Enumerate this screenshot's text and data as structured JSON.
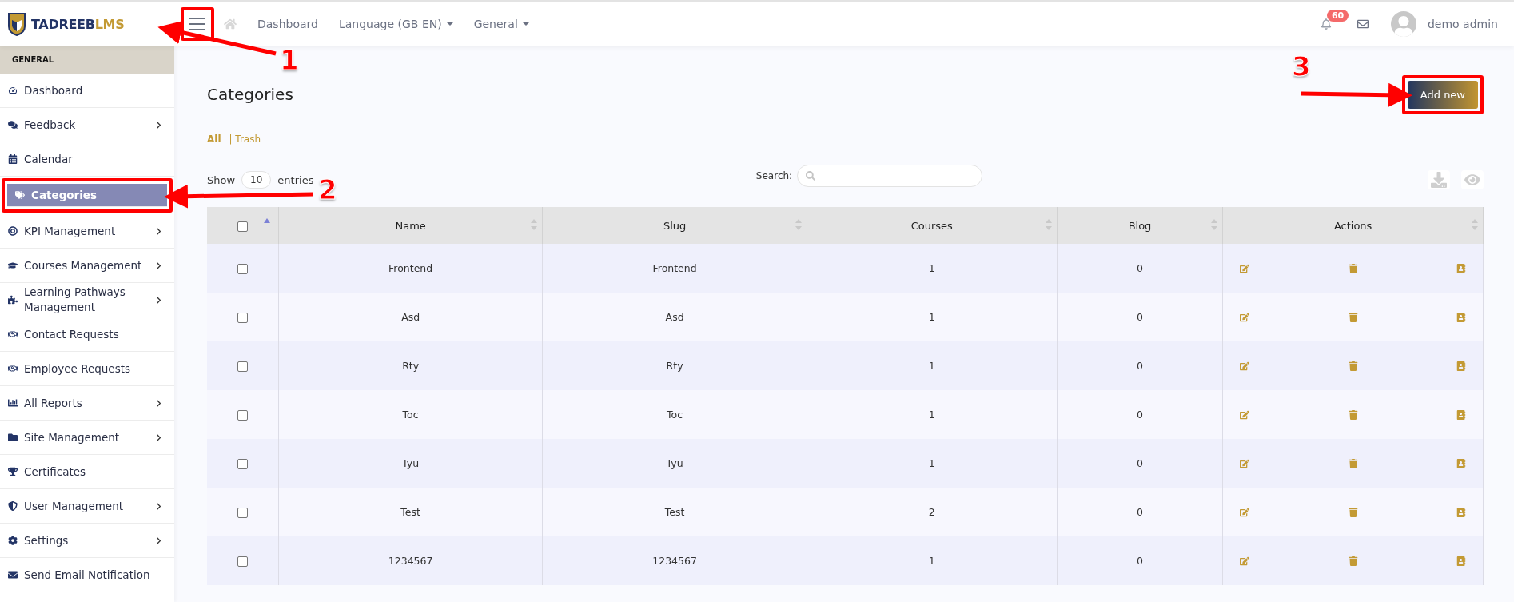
{
  "brand": {
    "name": "TADREEB",
    "suffix": "LMS"
  },
  "menu_button": {
    "annotated": true
  },
  "top_nav": [
    {
      "label": "Dashboard",
      "dropdown": false
    },
    {
      "label": "Language (GB EN)",
      "dropdown": true
    },
    {
      "label": "General",
      "dropdown": true
    }
  ],
  "notifications": {
    "count": "60"
  },
  "user": {
    "name": "demo admin"
  },
  "sidebar": {
    "section": "GENERAL",
    "items": [
      {
        "label": "Dashboard",
        "has_submenu": false,
        "selected": false,
        "annotated": false
      },
      {
        "label": "Feedback",
        "has_submenu": true,
        "selected": false,
        "annotated": false
      },
      {
        "label": "Calendar",
        "has_submenu": false,
        "selected": false,
        "annotated": false
      },
      {
        "label": "Categories",
        "has_submenu": false,
        "selected": true,
        "annotated": true
      },
      {
        "label": "KPI Management",
        "has_submenu": true,
        "selected": false,
        "annotated": false
      },
      {
        "label": "Courses Management",
        "has_submenu": true,
        "selected": false,
        "annotated": false
      },
      {
        "label": "Learning Pathways Management",
        "has_submenu": true,
        "selected": false,
        "annotated": false
      },
      {
        "label": "Contact Requests",
        "has_submenu": false,
        "selected": false,
        "annotated": false
      },
      {
        "label": "Employee Requests",
        "has_submenu": false,
        "selected": false,
        "annotated": false
      },
      {
        "label": "All Reports",
        "has_submenu": true,
        "selected": false,
        "annotated": false
      },
      {
        "label": "Site Management",
        "has_submenu": true,
        "selected": false,
        "annotated": false
      },
      {
        "label": "Certificates",
        "has_submenu": false,
        "selected": false,
        "annotated": false
      },
      {
        "label": "User Management",
        "has_submenu": true,
        "selected": false,
        "annotated": false
      },
      {
        "label": "Settings",
        "has_submenu": true,
        "selected": false,
        "annotated": false
      },
      {
        "label": "Send Email Notification",
        "has_submenu": false,
        "selected": false,
        "annotated": false
      }
    ]
  },
  "page_title": "Categories",
  "add_button": {
    "label": "Add new",
    "annotated": true
  },
  "filters": [
    {
      "label": "All",
      "selected": true
    },
    {
      "label": "| Trash",
      "selected": false
    }
  ],
  "length": {
    "before": "Show",
    "value": "10",
    "after": "entries"
  },
  "search": {
    "label": "Search:"
  },
  "table": {
    "select_all": {
      "checked": false
    },
    "columns": [
      "Name",
      "Slug",
      "Courses",
      "Blog",
      "Actions"
    ],
    "rows": [
      {
        "checked": false,
        "name": "Frontend",
        "slug": "Frontend",
        "courses": "1",
        "blog": "0"
      },
      {
        "checked": false,
        "name": "Asd",
        "slug": "Asd",
        "courses": "1",
        "blog": "0"
      },
      {
        "checked": false,
        "name": "Rty",
        "slug": "Rty",
        "courses": "1",
        "blog": "0"
      },
      {
        "checked": false,
        "name": "Toc",
        "slug": "Toc",
        "courses": "1",
        "blog": "0"
      },
      {
        "checked": false,
        "name": "Tyu",
        "slug": "Tyu",
        "courses": "1",
        "blog": "0"
      },
      {
        "checked": false,
        "name": "Test",
        "slug": "Test",
        "courses": "2",
        "blog": "0"
      },
      {
        "checked": false,
        "name": "1234567",
        "slug": "1234567",
        "courses": "1",
        "blog": "0"
      }
    ]
  },
  "annotations": [
    {
      "label": "1"
    },
    {
      "label": "2"
    },
    {
      "label": "3"
    }
  ]
}
